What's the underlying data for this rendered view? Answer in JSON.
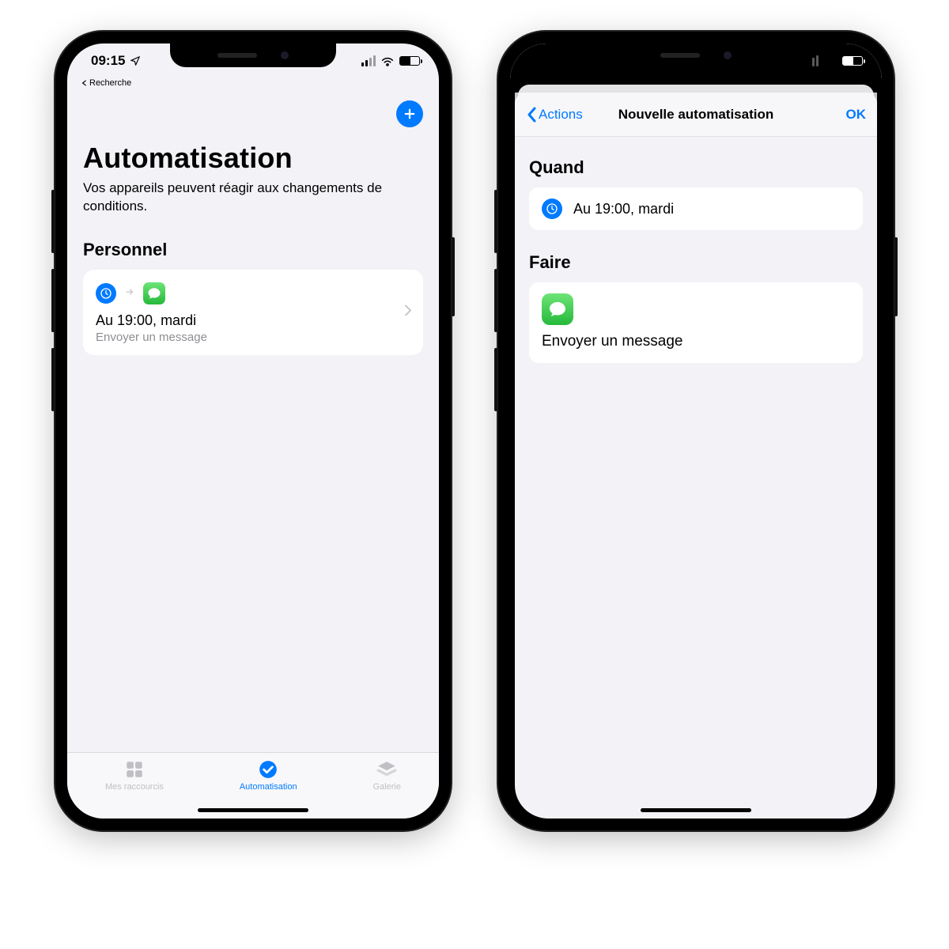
{
  "status": {
    "time": "09:15",
    "breadcrumb": "Recherche"
  },
  "phoneA": {
    "addLabel": "Ajouter",
    "title": "Automatisation",
    "subtitle": "Vos appareils peuvent réagir aux changements de conditions.",
    "sectionLabel": "Personnel",
    "automation": {
      "title": "Au 19:00, mardi",
      "subtitle": "Envoyer un message"
    },
    "tabs": [
      {
        "label": "Mes raccourcis"
      },
      {
        "label": "Automatisation"
      },
      {
        "label": "Galerie"
      }
    ]
  },
  "phoneB": {
    "back": "Actions",
    "title": "Nouvelle automatisation",
    "done": "OK",
    "whenLabel": "Quand",
    "whenRow": "Au 19:00, mardi",
    "doLabel": "Faire",
    "doRow": "Envoyer un message"
  }
}
